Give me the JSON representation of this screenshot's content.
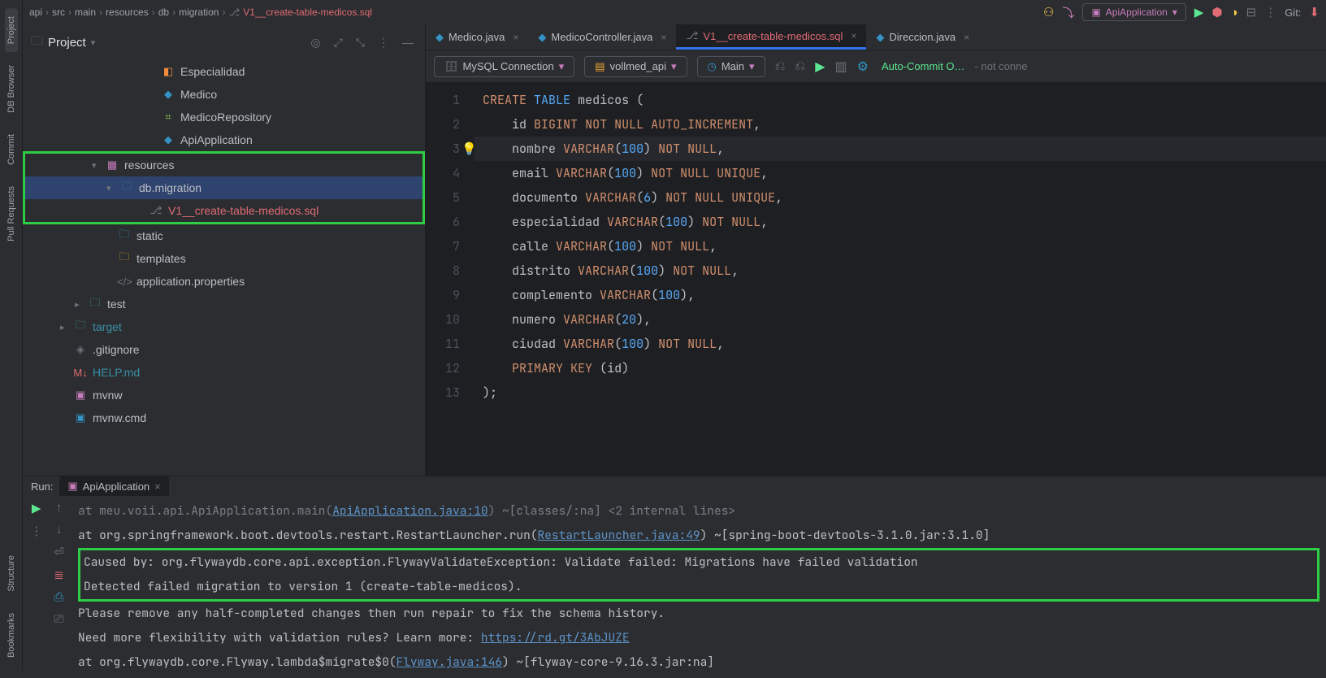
{
  "breadcrumb": [
    "api",
    "src",
    "main",
    "resources",
    "db",
    "migration"
  ],
  "breadcrumb_current": "V1__create-table-medicos.sql",
  "topbar": {
    "run_config": "ApiApplication",
    "git_label": "Git:"
  },
  "project_panel": {
    "title": "Project",
    "tree": [
      {
        "indent": 8,
        "icon": "◧",
        "iconColor": "#f28a3c",
        "label": "Especialidad"
      },
      {
        "indent": 8,
        "icon": "◆",
        "iconColor": "#3592c4",
        "label": "Medico"
      },
      {
        "indent": 8,
        "icon": "⌗",
        "iconColor": "#8fc65b",
        "label": "MedicoRepository"
      },
      {
        "indent": 8,
        "icon": "◆",
        "iconColor": "#3592c4",
        "label": "ApiApplication"
      },
      {
        "indent": 4,
        "arrow": "▾",
        "icon": "▦",
        "iconColor": "#c77dbb",
        "label": "resources",
        "boxed": true
      },
      {
        "indent": 5,
        "arrow": "▾",
        "icon": "🗀",
        "iconColor": "#3592c4",
        "label": "db.migration",
        "boxed": true,
        "sel": true
      },
      {
        "indent": 7,
        "icon": "⎇",
        "iconColor": "#6f737a",
        "label": "V1__create-table-medicos.sql",
        "boxed": true,
        "orange": true
      },
      {
        "indent": 5,
        "icon": "🗀",
        "iconColor": "#3592c4",
        "label": "static"
      },
      {
        "indent": 5,
        "icon": "🗀",
        "iconColor": "#f0a732",
        "label": "templates"
      },
      {
        "indent": 5,
        "icon": "</>",
        "iconColor": "#6f737a",
        "label": "application.properties"
      },
      {
        "indent": 3,
        "arrow": "▸",
        "icon": "🗀",
        "iconColor": "#3fa784",
        "label": "test"
      },
      {
        "indent": 2,
        "arrow": "▸",
        "icon": "🗀",
        "iconColor": "#3fa784",
        "label": "target",
        "teal": true
      },
      {
        "indent": 2,
        "icon": "◈",
        "iconColor": "#6f737a",
        "label": ".gitignore"
      },
      {
        "indent": 2,
        "icon": "M↓",
        "iconColor": "#e06c75",
        "label": "HELP.md",
        "teal": true
      },
      {
        "indent": 2,
        "icon": "▣",
        "iconColor": "#c77dbb",
        "label": "mvnw"
      },
      {
        "indent": 2,
        "icon": "▣",
        "iconColor": "#3592c4",
        "label": "mvnw.cmd"
      }
    ]
  },
  "file_tabs": [
    {
      "icon": "◆",
      "iconColor": "#3592c4",
      "label": "Medico.java"
    },
    {
      "icon": "◆",
      "iconColor": "#3592c4",
      "label": "MedicoController.java"
    },
    {
      "icon": "⎇",
      "iconColor": "#6f737a",
      "label": "V1__create-table-medicos.sql",
      "active": true,
      "modified": true
    },
    {
      "icon": "◆",
      "iconColor": "#3592c4",
      "label": "Direccion.java"
    }
  ],
  "db_toolbar": {
    "connection": "MySQL Connection",
    "schema": "vollmed_api",
    "session": "Main",
    "auto_commit": "Auto-Commit O…",
    "not_connected": "- not conne"
  },
  "code_lines": [
    {
      "n": 1,
      "html": "<span class='kw'>CREATE</span> <span class='fn'>TABLE</span> <span class='str'>medicos</span> <span class='paren'>(</span>"
    },
    {
      "n": 2,
      "html": "    <span class='str'>id</span> <span class='kw'>BIGINT</span> <span class='kw'>NOT NULL</span> <span class='kw'>AUTO_INCREMENT</span>,"
    },
    {
      "n": 3,
      "hl": true,
      "bulb": true,
      "html": "    <span class='str'>nombre</span> <span class='kw'>VARCHAR</span><span class='paren'>(</span><span class='fn'>100</span><span class='paren'>)</span> <span class='kw'>NOT NULL</span>,"
    },
    {
      "n": 4,
      "html": "    <span class='str'>email</span> <span class='kw'>VARCHAR</span><span class='paren'>(</span><span class='fn'>100</span><span class='paren'>)</span> <span class='kw'>NOT NULL UNIQUE</span>,"
    },
    {
      "n": 5,
      "html": "    <span class='str'>documento</span> <span class='kw'>VARCHAR</span><span class='paren'>(</span><span class='fn'>6</span><span class='paren'>)</span> <span class='kw'>NOT NULL UNIQUE</span>,"
    },
    {
      "n": 6,
      "html": "    <span class='str'>especialidad</span> <span class='kw'>VARCHAR</span><span class='paren'>(</span><span class='fn'>100</span><span class='paren'>)</span> <span class='kw'>NOT NULL</span>,"
    },
    {
      "n": 7,
      "html": "    <span class='str'>calle</span> <span class='kw'>VARCHAR</span><span class='paren'>(</span><span class='fn'>100</span><span class='paren'>)</span> <span class='kw'>NOT NULL</span>,"
    },
    {
      "n": 8,
      "html": "    <span class='str'>distrito</span> <span class='kw'>VARCHAR</span><span class='paren'>(</span><span class='fn'>100</span><span class='paren'>)</span> <span class='kw'>NOT NULL</span>,"
    },
    {
      "n": 9,
      "html": "    <span class='str'>complemento</span> <span class='kw'>VARCHAR</span><span class='paren'>(</span><span class='fn'>100</span><span class='paren'>)</span>,"
    },
    {
      "n": 10,
      "html": "    <span class='str'>numero</span> <span class='kw'>VARCHAR</span><span class='paren'>(</span><span class='fn'>20</span><span class='paren'>)</span>,"
    },
    {
      "n": 11,
      "html": "    <span class='str'>ciudad</span> <span class='kw'>VARCHAR</span><span class='paren'>(</span><span class='fn'>100</span><span class='paren'>)</span> <span class='kw'>NOT NULL</span>,"
    },
    {
      "n": 12,
      "html": "    <span class='kw'>PRIMARY KEY</span> <span class='paren'>(</span><span class='str'>id</span><span class='paren'>)</span>"
    },
    {
      "n": 13,
      "html": "<span class='paren'>);</span>"
    }
  ],
  "run": {
    "label": "Run:",
    "tab": "ApiApplication",
    "lines": [
      {
        "html": "<span class='muted'>    at meu.voii.api.ApiApplication.main(</span><span class='link'>ApiApplication.java:10</span><span class='muted'>) ~[classes/:na] &lt;2 internal lines&gt;</span>"
      },
      {
        "html": "    at org.springframework.boot.devtools.restart.RestartLauncher.run(<span class='link'>RestartLauncher.java:49</span>) ~[spring-boot-devtools-3.1.0.jar:3.1.0]"
      },
      {
        "boxed": true,
        "html": "Caused by: org.flywaydb.core.api.exception.FlywayValidateException: Validate failed: Migrations have failed validation<br>Detected failed migration to version 1 (create-table-medicos)."
      },
      {
        "html": "Please remove any half-completed changes then run repair to fix the schema history."
      },
      {
        "html": "Need more flexibility with validation rules? Learn more: <span class='link'>https://rd.gt/3AbJUZE</span>"
      },
      {
        "html": "    at org.flywaydb.core.Flyway.lambda$migrate$0(<span class='link'>Flyway.java:146</span>) ~[flyway-core-9.16.3.jar:na]"
      }
    ]
  },
  "left_tabs": [
    "Project",
    "DB Browser",
    "Commit",
    "Pull Requests"
  ],
  "left_bottom": [
    "Structure",
    "Bookmarks"
  ]
}
